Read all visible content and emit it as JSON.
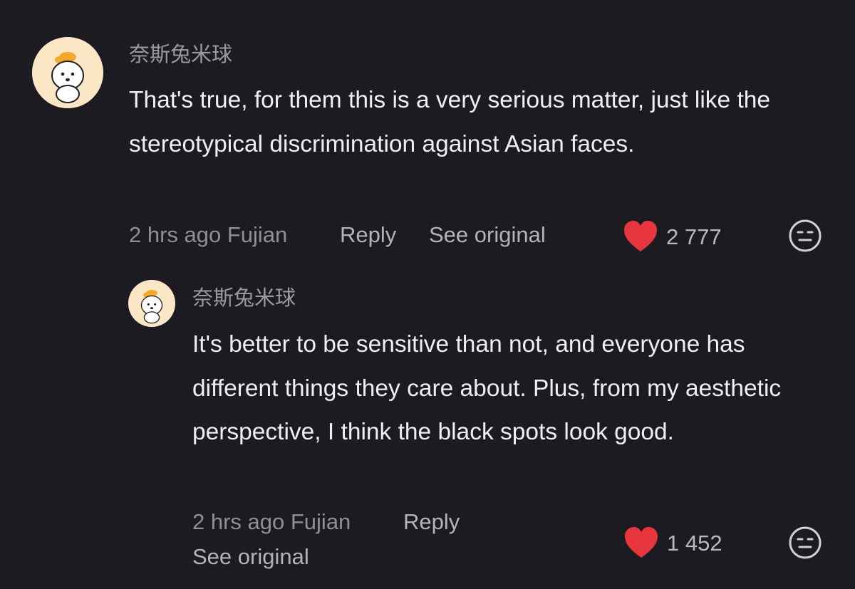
{
  "comments": [
    {
      "username": "奈斯兔米球",
      "text": "That's true, for them this is a very serious matter, just like the stereotypical discrimination against Asian faces.",
      "time_location": "2 hrs ago Fujian",
      "reply_label": "Reply",
      "see_original_label": "See original",
      "likes": "2 777",
      "avatar_icon": "bunny-avatar-icon",
      "like_icon": "heart-icon",
      "reaction_icon": "meh-face-icon"
    },
    {
      "username": "奈斯兔米球",
      "text": "It's better to be sensitive than not, and everyone has different things they care about. Plus, from my aesthetic perspective, I think the black spots look good.",
      "time_location": "2 hrs ago Fujian",
      "reply_label": "Reply",
      "see_original_label": "See original",
      "likes": "1 452",
      "avatar_icon": "bunny-avatar-icon",
      "like_icon": "heart-icon",
      "reaction_icon": "meh-face-icon"
    }
  ],
  "colors": {
    "background": "#1c1b21",
    "heart": "#e8363f",
    "avatar_bg": "#fbe7c6",
    "hat": "#f3a92d"
  }
}
